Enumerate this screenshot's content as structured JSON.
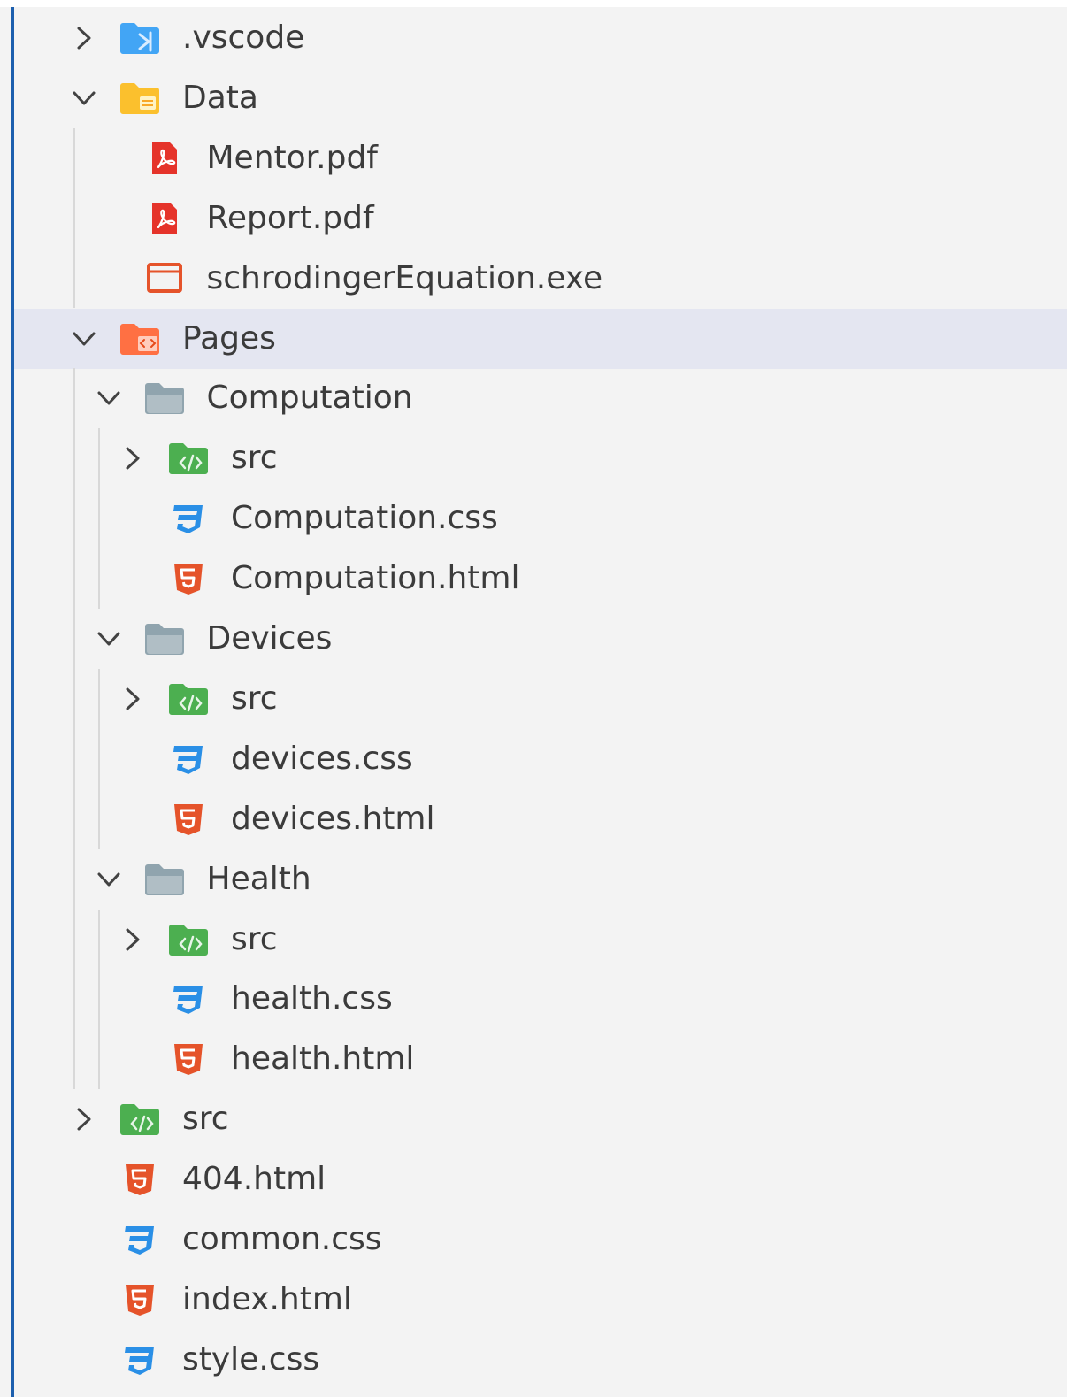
{
  "explorer": {
    "items": [
      {
        "label": ".vscode",
        "kind": "folder",
        "icon": "vscode-folder-icon",
        "depth": 0,
        "expanded": false
      },
      {
        "label": "Data",
        "kind": "folder",
        "icon": "data-folder-icon",
        "depth": 0,
        "expanded": true
      },
      {
        "label": "Mentor.pdf",
        "kind": "file",
        "icon": "pdf-icon",
        "depth": 1
      },
      {
        "label": "Report.pdf",
        "kind": "file",
        "icon": "pdf-icon",
        "depth": 1
      },
      {
        "label": "schrodingerEquation.exe",
        "kind": "file",
        "icon": "exe-icon",
        "depth": 1
      },
      {
        "label": "Pages",
        "kind": "folder",
        "icon": "pages-folder-icon",
        "depth": 0,
        "expanded": true,
        "selected": true
      },
      {
        "label": "Computation",
        "kind": "folder",
        "icon": "folder-icon",
        "depth": 1,
        "expanded": true
      },
      {
        "label": "src",
        "kind": "folder",
        "icon": "src-folder-icon",
        "depth": 2,
        "expanded": false
      },
      {
        "label": "Computation.css",
        "kind": "file",
        "icon": "css-icon",
        "depth": 2
      },
      {
        "label": "Computation.html",
        "kind": "file",
        "icon": "html-icon",
        "depth": 2
      },
      {
        "label": "Devices",
        "kind": "folder",
        "icon": "folder-icon",
        "depth": 1,
        "expanded": true
      },
      {
        "label": "src",
        "kind": "folder",
        "icon": "src-folder-icon",
        "depth": 2,
        "expanded": false
      },
      {
        "label": "devices.css",
        "kind": "file",
        "icon": "css-icon",
        "depth": 2
      },
      {
        "label": "devices.html",
        "kind": "file",
        "icon": "html-icon",
        "depth": 2
      },
      {
        "label": "Health",
        "kind": "folder",
        "icon": "folder-icon",
        "depth": 1,
        "expanded": true
      },
      {
        "label": "src",
        "kind": "folder",
        "icon": "src-folder-icon",
        "depth": 2,
        "expanded": false
      },
      {
        "label": "health.css",
        "kind": "file",
        "icon": "css-icon",
        "depth": 2
      },
      {
        "label": "health.html",
        "kind": "file",
        "icon": "html-icon",
        "depth": 2
      },
      {
        "label": "src",
        "kind": "folder",
        "icon": "src-folder-icon",
        "depth": 0,
        "expanded": false
      },
      {
        "label": "404.html",
        "kind": "file",
        "icon": "html-icon",
        "depth": 0
      },
      {
        "label": "common.css",
        "kind": "file",
        "icon": "css-icon",
        "depth": 0
      },
      {
        "label": "index.html",
        "kind": "file",
        "icon": "html-icon",
        "depth": 0
      },
      {
        "label": "style.css",
        "kind": "file",
        "icon": "css-icon",
        "depth": 0
      }
    ],
    "colors": {
      "selection": "#e4e6f1",
      "focus_border": "#1c5fae",
      "pdf": "#e5332a",
      "exe": "#e5532a",
      "css": "#2a8fe6",
      "html": "#e5532a",
      "src_folder": "#4caf50",
      "plain_folder": "#90a4ae",
      "data_folder": "#fbc02d",
      "pages_folder": "#ff7043",
      "vscode_folder": "#42a5f5"
    }
  }
}
